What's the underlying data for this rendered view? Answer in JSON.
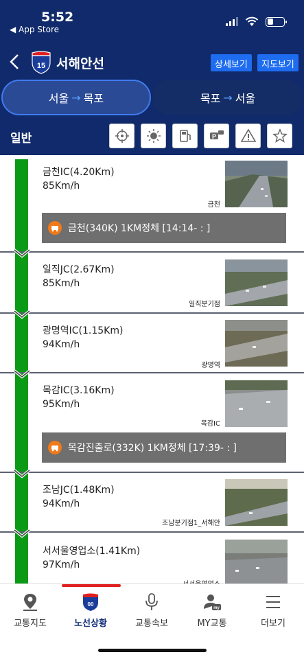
{
  "status": {
    "time": "5:52",
    "back_app": "◀ App Store"
  },
  "header": {
    "title": "서해안선",
    "route_number": "15",
    "detail_button": "상세보기",
    "map_button": "지도보기"
  },
  "direction": {
    "active_from": "서울",
    "active_to": "목포",
    "inactive_from": "목포",
    "inactive_to": "서울",
    "arrow": "→"
  },
  "filter": {
    "label": "일반",
    "icons": [
      "cctv-target-icon",
      "weather-sun-icon",
      "gas-station-icon",
      "parking-icon",
      "warning-icon",
      "star-icon"
    ]
  },
  "segments": [
    {
      "name": "금천IC(4.20Km)",
      "speed": "85Km/h",
      "cam_label": "금천",
      "alert": "금천(340K)  1KM정체 [14:14-  :  ]"
    },
    {
      "name": "일직JC(2.67Km)",
      "speed": "85Km/h",
      "cam_label": "일직분기점",
      "alert": ""
    },
    {
      "name": "광명역IC(1.15Km)",
      "speed": "94Km/h",
      "cam_label": "광명역",
      "alert": ""
    },
    {
      "name": "목감IC(3.16Km)",
      "speed": "95Km/h",
      "cam_label": "목감IC",
      "alert": "목감진출로(332K)  1KM정체 [17:39-  :  ]"
    },
    {
      "name": "조남JC(1.48Km)",
      "speed": "94Km/h",
      "cam_label": "조남분기점1_서해안",
      "alert": ""
    },
    {
      "name": "서서울영업소(1.41Km)",
      "speed": "97Km/h",
      "cam_label": "서서울영업소",
      "alert": ""
    }
  ],
  "nav": [
    {
      "label": "교통지도",
      "icon": "map-pin-icon"
    },
    {
      "label": "노선상황",
      "icon": "route-shield-icon"
    },
    {
      "label": "교통속보",
      "icon": "microphone-icon"
    },
    {
      "label": "MY교통",
      "icon": "user-my-icon"
    },
    {
      "label": "더보기",
      "icon": "menu-icon"
    }
  ],
  "colors": {
    "navy": "#102a6b",
    "accent": "#1e6df0",
    "green": "#0a9a16",
    "active_nav": "#15307a",
    "indicator": "#e02020"
  }
}
